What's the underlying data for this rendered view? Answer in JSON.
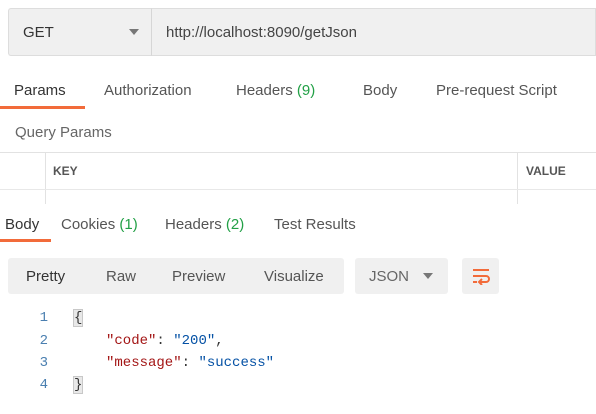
{
  "request": {
    "method": "GET",
    "url": "http://localhost:8090/getJson"
  },
  "request_tabs": [
    {
      "label": "Params",
      "count": ""
    },
    {
      "label": "Authorization",
      "count": ""
    },
    {
      "label": "Headers",
      "count": "(9)"
    },
    {
      "label": "Body",
      "count": ""
    },
    {
      "label": "Pre-request Script",
      "count": ""
    }
  ],
  "query_params": {
    "title": "Query Params",
    "columns": [
      "KEY",
      "VALUE"
    ]
  },
  "response_tabs": [
    {
      "label": "Body",
      "count": ""
    },
    {
      "label": "Cookies",
      "count": "(1)"
    },
    {
      "label": "Headers",
      "count": "(2)"
    },
    {
      "label": "Test Results",
      "count": ""
    }
  ],
  "view_modes": [
    "Pretty",
    "Raw",
    "Preview",
    "Visualize"
  ],
  "active_view_mode": "Pretty",
  "format_select": "JSON",
  "code": {
    "line_numbers": [
      "1",
      "2",
      "3",
      "4"
    ],
    "open_brace": "{",
    "close_brace": "}",
    "entries": [
      {
        "key": "\"code\"",
        "sep": ": ",
        "value": "\"200\"",
        "trail": ","
      },
      {
        "key": "\"message\"",
        "sep": ": ",
        "value": "\"success\"",
        "trail": ""
      }
    ]
  },
  "colors": {
    "accent": "#f26b3a",
    "count_green": "#22a046",
    "json_key": "#a31515",
    "json_string": "#0451a5"
  }
}
